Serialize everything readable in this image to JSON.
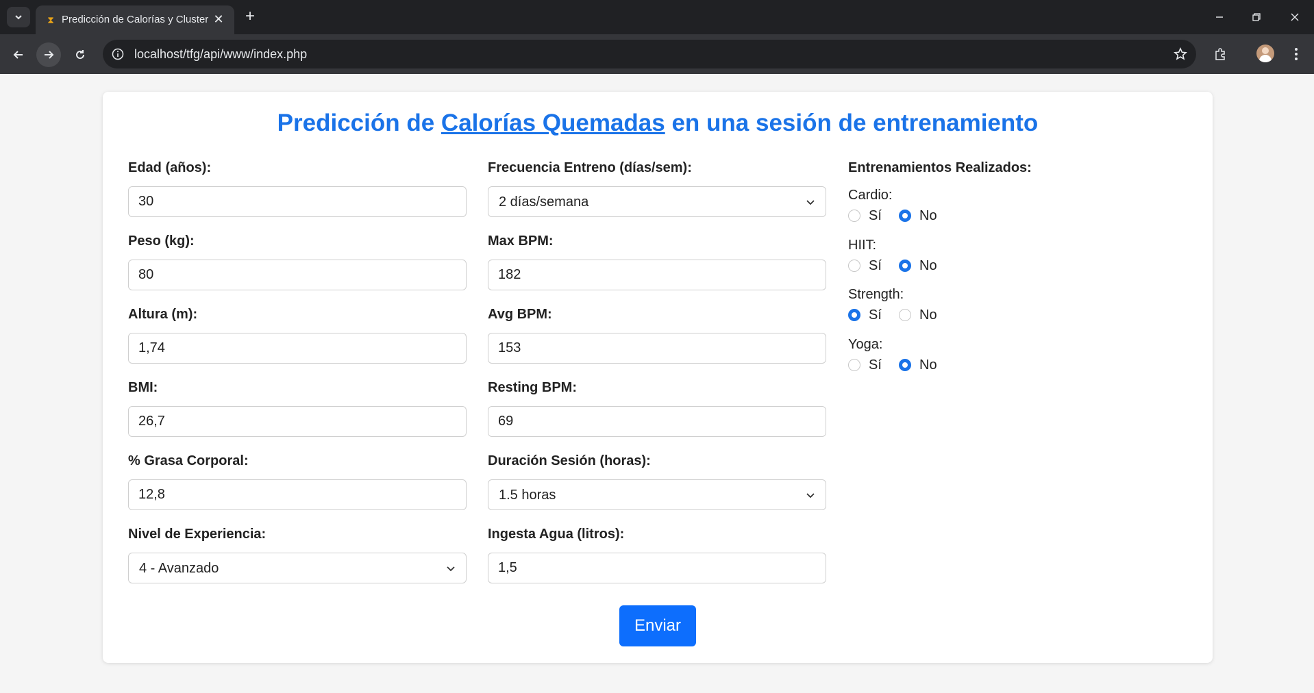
{
  "browser": {
    "tab_title": "Predicción de Calorías y Cluster",
    "url": "localhost/tfg/api/www/index.php"
  },
  "page": {
    "title_part1": "Predicción de ",
    "title_highlight": "Calorías Quemadas",
    "title_part2": " en una sesión de entrenamiento"
  },
  "form": {
    "column1": [
      {
        "label": "Edad (años):",
        "type": "input",
        "value": "30"
      },
      {
        "label": "Peso (kg):",
        "type": "input",
        "value": "80"
      },
      {
        "label": "Altura (m):",
        "type": "input",
        "value": "1,74"
      },
      {
        "label": "BMI:",
        "type": "input",
        "value": "26,7"
      },
      {
        "label": "% Grasa Corporal:",
        "type": "input",
        "value": "12,8"
      },
      {
        "label": "Nivel de Experiencia:",
        "type": "select",
        "value": "4 - Avanzado"
      }
    ],
    "column2": [
      {
        "label": "Frecuencia Entreno (días/sem):",
        "type": "select",
        "value": "2 días/semana"
      },
      {
        "label": "Max BPM:",
        "type": "input",
        "value": "182"
      },
      {
        "label": "Avg BPM:",
        "type": "input",
        "value": "153"
      },
      {
        "label": "Resting BPM:",
        "type": "input",
        "value": "69"
      },
      {
        "label": "Duración Sesión (horas):",
        "type": "select",
        "value": "1.5 horas"
      },
      {
        "label": "Ingesta Agua (litros):",
        "type": "input",
        "value": "1,5"
      }
    ],
    "trainings": {
      "title": "Entrenamientos Realizados:",
      "yes_label": "Sí",
      "no_label": "No",
      "groups": [
        {
          "label": "Cardio:",
          "selected": "No"
        },
        {
          "label": "HIIT:",
          "selected": "No"
        },
        {
          "label": "Strength:",
          "selected": "Sí"
        },
        {
          "label": "Yoga:",
          "selected": "No"
        }
      ]
    },
    "submit_label": "Enviar"
  },
  "colors": {
    "accent": "#1a73e8",
    "button": "#0d6efd",
    "chrome_dark": "#202124",
    "chrome_toolbar": "#35363a"
  }
}
